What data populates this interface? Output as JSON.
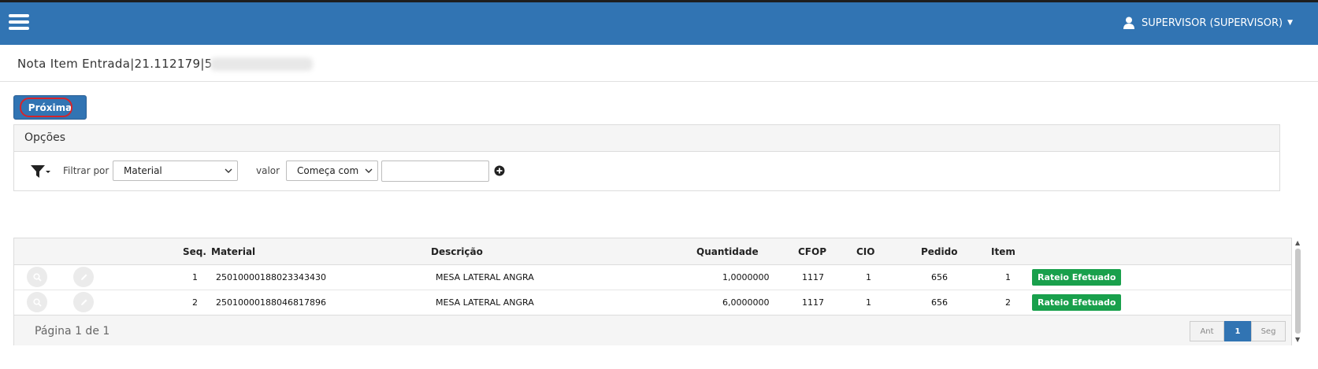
{
  "topbar": {
    "menu_icon": "hamburger-icon",
    "user_icon": "user-icon",
    "user_label": "SUPERVISOR (SUPERVISOR)",
    "color": "#3174b3"
  },
  "page": {
    "title": "Nota Item Entrada|21.112179|5"
  },
  "toolbar": {
    "next_label": "Próxima"
  },
  "options": {
    "header": "Opções",
    "filter_icon": "filter-icon",
    "filter_by_label": "Filtrar por",
    "filter_field": "Material",
    "value_label": "valor",
    "operator": "Começa com",
    "value": "",
    "add_icon": "plus-circle-icon"
  },
  "grid": {
    "columns": {
      "seq": "Seq.",
      "material": "Material",
      "descricao": "Descrição",
      "quantidade": "Quantidade",
      "cfop": "CFOP",
      "cio": "CIO",
      "pedido": "Pedido",
      "item": "Item"
    },
    "rows": [
      {
        "seq": "1",
        "material": "25010000188023343430",
        "descricao": "MESA LATERAL ANGRA",
        "quantidade": "1,0000000",
        "cfop": "1117",
        "cio": "1",
        "pedido": "656",
        "item": "1",
        "status": "Rateio Efetuado"
      },
      {
        "seq": "2",
        "material": "25010000188046817896",
        "descricao": "MESA LATERAL ANGRA",
        "quantidade": "6,0000000",
        "cfop": "1117",
        "cio": "1",
        "pedido": "656",
        "item": "2",
        "status": "Rateio Efetuado"
      }
    ],
    "row_icons": [
      "search-icon",
      "pencil-icon"
    ],
    "status_color": "#19a04c"
  },
  "pagination": {
    "info": "Página 1 de 1",
    "prev": "Ant",
    "current": "1",
    "next": "Seg"
  }
}
